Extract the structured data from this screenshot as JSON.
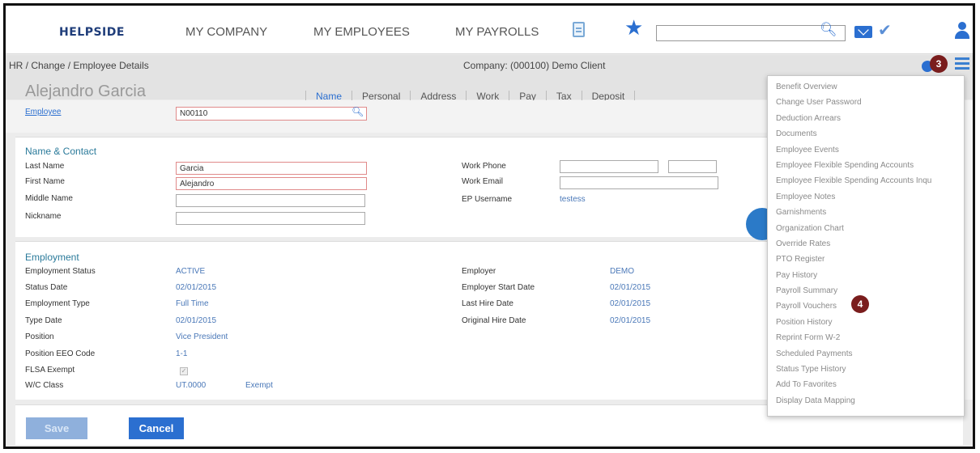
{
  "nav": {
    "logo": "HELPSIDE",
    "links": [
      "MY COMPANY",
      "MY EMPLOYEES",
      "MY PAYROLLS"
    ],
    "search_placeholder": "",
    "icons": [
      "document-icon",
      "star-icon",
      "search-icon",
      "mail-icon",
      "check-icon",
      "user-icon"
    ]
  },
  "header": {
    "breadcrumb": "HR / Change / Employee Details",
    "company": "Company: (000100) Demo Client",
    "employee_name": "Alejandro Garcia",
    "tabs": [
      "Name",
      "Personal",
      "Address",
      "Work",
      "Pay",
      "Tax",
      "Deposit"
    ],
    "active_tab": "Name"
  },
  "employee": {
    "label": "Employee",
    "value": "N00110"
  },
  "name_contact": {
    "title": "Name & Contact",
    "last_name_label": "Last Name",
    "last_name": "Garcia",
    "first_name_label": "First Name",
    "first_name": "Alejandro",
    "middle_name_label": "Middle Name",
    "middle_name": "",
    "nickname_label": "Nickname",
    "nickname": "",
    "work_phone_label": "Work Phone",
    "work_phone": "",
    "work_phone_ext": "",
    "work_email_label": "Work Email",
    "work_email": "",
    "ep_username_label": "EP Username",
    "ep_username": "testess"
  },
  "employment": {
    "title": "Employment",
    "status_label": "Employment Status",
    "status": "ACTIVE",
    "status_date_label": "Status Date",
    "status_date": "02/01/2015",
    "type_label": "Employment Type",
    "type": "Full Time",
    "type_date_label": "Type Date",
    "type_date": "02/01/2015",
    "position_label": "Position",
    "position": "Vice President",
    "eeo_label": "Position EEO Code",
    "eeo": "1-1",
    "flsa_label": "FLSA Exempt",
    "wc_label": "W/C Class",
    "wc_class": "UT.0000",
    "wc_exempt": "Exempt",
    "employer_label": "Employer",
    "employer": "DEMO",
    "employer_start_label": "Employer Start Date",
    "employer_start": "02/01/2015",
    "last_hire_label": "Last Hire Date",
    "last_hire": "02/01/2015",
    "orig_hire_label": "Original Hire Date",
    "orig_hire": "02/01/2015"
  },
  "footer": {
    "save_label": "Save",
    "cancel_label": "Cancel"
  },
  "menu": {
    "badge_menu": "3",
    "badge_item": "4",
    "items": [
      "Benefit Overview",
      "Change User Password",
      "Deduction Arrears",
      "Documents",
      "Employee Events",
      "Employee Flexible Spending Accounts",
      "Employee Flexible Spending Accounts Inqu",
      "Employee Notes",
      "Garnishments",
      "Organization Chart",
      "Override Rates",
      "PTO Register",
      "Pay History",
      "Payroll Summary",
      "Payroll Vouchers",
      "Position History",
      "Reprint Form W-2",
      "Scheduled Payments",
      "Status Type History",
      "Add To Favorites",
      "Display Data Mapping"
    ]
  },
  "colors": {
    "accent": "#2b6fd0",
    "badge": "#7a1d1d",
    "section_title": "#2a7a9a"
  }
}
